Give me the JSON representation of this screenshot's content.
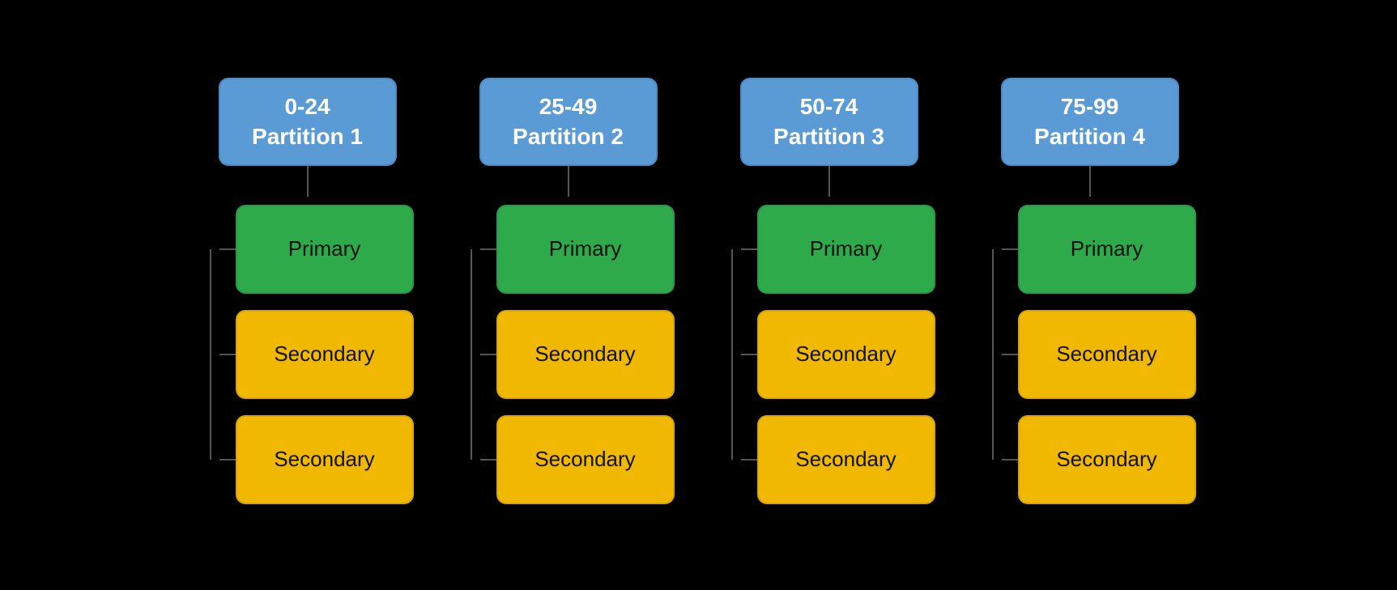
{
  "diagram": {
    "partitions": [
      {
        "id": "p1",
        "range": "0-24",
        "label": "Partition 1",
        "primary_label": "Primary",
        "secondary_label": "Secondary"
      },
      {
        "id": "p2",
        "range": "25-49",
        "label": "Partition 2",
        "primary_label": "Primary",
        "secondary_label": "Secondary"
      },
      {
        "id": "p3",
        "range": "50-74",
        "label": "Partition 3",
        "primary_label": "Primary",
        "secondary_label": "Secondary"
      },
      {
        "id": "p4",
        "range": "75-99",
        "label": "Partition 4",
        "primary_label": "Primary",
        "secondary_label": "Secondary"
      }
    ]
  }
}
